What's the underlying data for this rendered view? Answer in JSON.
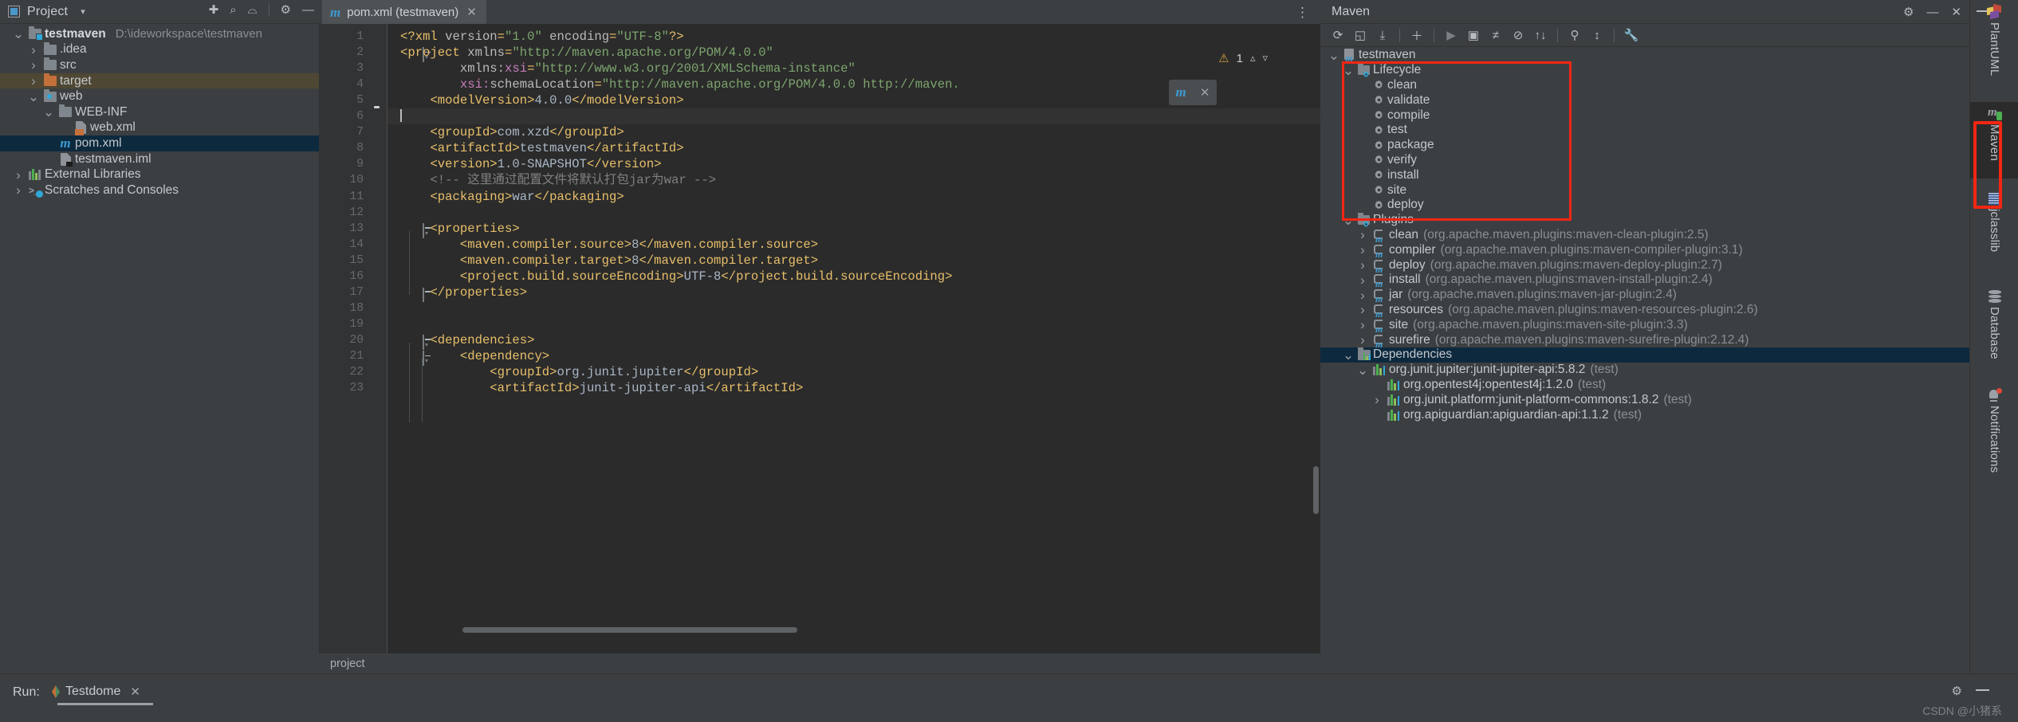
{
  "project_panel": {
    "title": "Project",
    "caret_icon": "chevron-down-icon",
    "toolbar_icons": [
      "locate-icon",
      "expand-all-icon",
      "collapse-all-icon",
      "gear-icon",
      "hide-icon"
    ],
    "tree": [
      {
        "label": "testmaven",
        "path": "D:\\ideworkspace\\testmaven",
        "icon": "module-folder-icon",
        "indent": 0,
        "expanded": true,
        "bold": true,
        "selected": "none"
      },
      {
        "label": ".idea",
        "path": "",
        "icon": "folder-icon",
        "indent": 1,
        "expanded": false,
        "bold": false,
        "selected": "none"
      },
      {
        "label": "src",
        "path": "",
        "icon": "folder-icon",
        "indent": 1,
        "expanded": false,
        "bold": false,
        "selected": "none"
      },
      {
        "label": "target",
        "path": "",
        "icon": "folder-orange-icon",
        "indent": 1,
        "expanded": false,
        "bold": false,
        "selected": "amber"
      },
      {
        "label": "web",
        "path": "",
        "icon": "folder-web-icon",
        "indent": 1,
        "expanded": true,
        "bold": false,
        "selected": "none"
      },
      {
        "label": "WEB-INF",
        "path": "",
        "icon": "folder-icon",
        "indent": 2,
        "expanded": true,
        "bold": false,
        "selected": "none"
      },
      {
        "label": "web.xml",
        "path": "",
        "icon": "xml-file-icon",
        "indent": 3,
        "expanded": null,
        "bold": false,
        "selected": "none"
      },
      {
        "label": "pom.xml",
        "path": "",
        "icon": "maven-m-icon",
        "indent": 2,
        "expanded": null,
        "bold": false,
        "selected": "blue"
      },
      {
        "label": "testmaven.iml",
        "path": "",
        "icon": "iml-file-icon",
        "indent": 2,
        "expanded": null,
        "bold": false,
        "selected": "none"
      },
      {
        "label": "External Libraries",
        "path": "",
        "icon": "library-icon",
        "indent": 0,
        "expanded": false,
        "bold": false,
        "selected": "none"
      },
      {
        "label": "Scratches and Consoles",
        "path": "",
        "icon": "scratches-icon",
        "indent": 0,
        "expanded": false,
        "bold": false,
        "selected": "none"
      }
    ]
  },
  "editor": {
    "tab": {
      "label": "pom.xml (testmaven)",
      "icon": "maven-m-icon",
      "close_icon": "close-icon"
    },
    "kebab_icon": "more-options-icon",
    "inspection": {
      "count": "1",
      "warning_icon": "warning-triangle-icon",
      "up_icon": "arrow-up-icon",
      "down_icon": "arrow-down-icon"
    },
    "floating_popup": {
      "icon": "maven-reload-icon",
      "close_icon": "close-icon"
    },
    "breadcrumb": "project",
    "cursor_line": 6,
    "lines": [
      {
        "n": 1,
        "fold": "none",
        "bulb": false,
        "html": "<span class=\"punc\">&lt;?xml </span><span class=\"attr\">version</span><span class=\"punc\">=</span><span class=\"attrv\">\"1.0\"</span><span class=\"attr\"> encoding</span><span class=\"punc\">=</span><span class=\"attrv\">\"UTF-8\"</span><span class=\"punc\">?&gt;</span>"
      },
      {
        "n": 2,
        "fold": "open",
        "bulb": false,
        "html": "<span class=\"tag\">&lt;project </span><span class=\"attr\">xmlns</span><span class=\"punc\">=</span><span class=\"attrv\">\"http://maven.apache.org/POM/4.0.0\"</span>"
      },
      {
        "n": 3,
        "fold": "none",
        "bulb": false,
        "html": "        <span class=\"attr\">xmlns:</span><span class=\"ns\">xsi</span><span class=\"punc\">=</span><span class=\"attrv\">\"http://www.w3.org/2001/XMLSchema-instance\"</span>"
      },
      {
        "n": 4,
        "fold": "none",
        "bulb": false,
        "html": "        <span class=\"ns\">xsi:</span><span class=\"attr\">schemaLocation</span><span class=\"punc\">=</span><span class=\"attrv\">\"http://maven.apache.org/POM/4.0.0 http://maven.</span>"
      },
      {
        "n": 5,
        "fold": "none",
        "bulb": true,
        "html": "    <span class=\"tag\">&lt;modelVersion&gt;</span><span class=\"txt\">4.0.0</span><span class=\"tag\">&lt;/modelVersion&gt;</span>"
      },
      {
        "n": 6,
        "fold": "none",
        "bulb": false,
        "html": "<span class=\"caret-line\"></span>"
      },
      {
        "n": 7,
        "fold": "none",
        "bulb": false,
        "html": "    <span class=\"tag\">&lt;groupId&gt;</span><span class=\"txt\">com.xzd</span><span class=\"tag\">&lt;/groupId&gt;</span>"
      },
      {
        "n": 8,
        "fold": "none",
        "bulb": false,
        "html": "    <span class=\"tag\">&lt;artifactId&gt;</span><span class=\"txt\">testmaven</span><span class=\"tag\">&lt;/artifactId&gt;</span>"
      },
      {
        "n": 9,
        "fold": "none",
        "bulb": false,
        "html": "    <span class=\"tag\">&lt;version&gt;</span><span class=\"txt\">1.0-SNAPSHOT</span><span class=\"tag\">&lt;/version&gt;</span>"
      },
      {
        "n": 10,
        "fold": "none",
        "bulb": false,
        "html": "    <span class=\"cmt\">&lt;!-- 这里通过配置文件将默认打包jar为war --&gt;</span>"
      },
      {
        "n": 11,
        "fold": "none",
        "bulb": false,
        "html": "    <span class=\"tag\">&lt;packaging&gt;</span><span class=\"txt\">war</span><span class=\"tag\">&lt;/packaging&gt;</span>"
      },
      {
        "n": 12,
        "fold": "none",
        "bulb": false,
        "html": ""
      },
      {
        "n": 13,
        "fold": "open",
        "bulb": false,
        "html": "    <span class=\"tag\">&lt;properties&gt;</span>"
      },
      {
        "n": 14,
        "fold": "none",
        "bulb": false,
        "html": "        <span class=\"tag\">&lt;maven.compiler.source&gt;</span><span class=\"txt\">8</span><span class=\"tag\">&lt;/maven.compiler.source&gt;</span>"
      },
      {
        "n": 15,
        "fold": "none",
        "bulb": false,
        "html": "        <span class=\"tag\">&lt;maven.compiler.target&gt;</span><span class=\"txt\">8</span><span class=\"tag\">&lt;/maven.compiler.target&gt;</span>"
      },
      {
        "n": 16,
        "fold": "none",
        "bulb": false,
        "html": "        <span class=\"tag\">&lt;project.build.sourceEncoding&gt;</span><span class=\"txt\">UTF-8</span><span class=\"tag\">&lt;/project.build.sourceEncoding&gt;</span>"
      },
      {
        "n": 17,
        "fold": "close",
        "bulb": false,
        "html": "    <span class=\"tag\">&lt;/properties&gt;</span>"
      },
      {
        "n": 18,
        "fold": "none",
        "bulb": false,
        "html": ""
      },
      {
        "n": 19,
        "fold": "none",
        "bulb": false,
        "html": ""
      },
      {
        "n": 20,
        "fold": "open",
        "bulb": false,
        "html": "    <span class=\"tag\">&lt;dependencies&gt;</span>"
      },
      {
        "n": 21,
        "fold": "open",
        "bulb": false,
        "html": "        <span class=\"tag\">&lt;dependency&gt;</span>"
      },
      {
        "n": 22,
        "fold": "none",
        "bulb": false,
        "html": "            <span class=\"tag\">&lt;groupId&gt;</span><span class=\"txt\">org.junit.jupiter</span><span class=\"tag\">&lt;/groupId&gt;</span>"
      },
      {
        "n": 23,
        "fold": "none",
        "bulb": false,
        "html": "            <span class=\"tag\">&lt;artifactId&gt;</span><span class=\"txt\">junit-jupiter-api</span><span class=\"tag\">&lt;/artifactId&gt;</span>"
      }
    ]
  },
  "maven_panel": {
    "title": "Maven",
    "header_icons": [
      "gear-icon",
      "hide-icon",
      "close-icon"
    ],
    "toolbar": [
      {
        "name": "reload-all-projects-icon",
        "glyph": "⟳",
        "dim": false
      },
      {
        "name": "add-maven-project-icon",
        "glyph": "◱",
        "dim": false
      },
      {
        "name": "download-sources-icon",
        "glyph": "⤓",
        "dim": false
      },
      {
        "name": "separator",
        "glyph": "",
        "dim": false
      },
      {
        "name": "add-icon",
        "glyph": "＋",
        "dim": false
      },
      {
        "name": "separator",
        "glyph": "",
        "dim": false
      },
      {
        "name": "run-icon",
        "glyph": "▶",
        "dim": true
      },
      {
        "name": "execute-goal-icon",
        "glyph": "▣",
        "dim": false
      },
      {
        "name": "toggle-skip-tests-icon",
        "glyph": "≠",
        "dim": false
      },
      {
        "name": "toggle-offline-icon",
        "glyph": "⊘",
        "dim": false
      },
      {
        "name": "collapse-all-icon",
        "glyph": "↑↓",
        "dim": false
      },
      {
        "name": "separator",
        "glyph": "",
        "dim": false
      },
      {
        "name": "show-dependencies-icon",
        "glyph": "⚲",
        "dim": false
      },
      {
        "name": "expand-icon",
        "glyph": "↕",
        "dim": false
      },
      {
        "name": "separator",
        "glyph": "",
        "dim": false
      },
      {
        "name": "maven-settings-icon",
        "glyph": "🔧",
        "dim": false
      }
    ],
    "root": {
      "label": "testmaven",
      "icon": "maven-module-icon",
      "expanded": true
    },
    "lifecycle": {
      "label": "Lifecycle",
      "icon": "folder-gear-icon",
      "expanded": true,
      "highlighted": true,
      "goals": [
        {
          "label": "clean",
          "icon": "gear-icon"
        },
        {
          "label": "validate",
          "icon": "gear-icon"
        },
        {
          "label": "compile",
          "icon": "gear-icon"
        },
        {
          "label": "test",
          "icon": "gear-icon"
        },
        {
          "label": "package",
          "icon": "gear-icon"
        },
        {
          "label": "verify",
          "icon": "gear-icon"
        },
        {
          "label": "install",
          "icon": "gear-icon"
        },
        {
          "label": "site",
          "icon": "gear-icon"
        },
        {
          "label": "deploy",
          "icon": "gear-icon"
        }
      ]
    },
    "plugins": {
      "label": "Plugins",
      "icon": "folder-gear-icon",
      "expanded": true,
      "items": [
        {
          "name": "clean",
          "coord": "(org.apache.maven.plugins:maven-clean-plugin:2.5)"
        },
        {
          "name": "compiler",
          "coord": "(org.apache.maven.plugins:maven-compiler-plugin:3.1)"
        },
        {
          "name": "deploy",
          "coord": "(org.apache.maven.plugins:maven-deploy-plugin:2.7)"
        },
        {
          "name": "install",
          "coord": "(org.apache.maven.plugins:maven-install-plugin:2.4)"
        },
        {
          "name": "jar",
          "coord": "(org.apache.maven.plugins:maven-jar-plugin:2.4)"
        },
        {
          "name": "resources",
          "coord": "(org.apache.maven.plugins:maven-resources-plugin:2.6)"
        },
        {
          "name": "site",
          "coord": "(org.apache.maven.plugins:maven-site-plugin:3.3)"
        },
        {
          "name": "surefire",
          "coord": "(org.apache.maven.plugins:maven-surefire-plugin:2.12.4)"
        }
      ]
    },
    "dependencies": {
      "label": "Dependencies",
      "icon": "dependencies-folder-icon",
      "expanded": true,
      "selected": true,
      "items": [
        {
          "label": "org.junit.jupiter:junit-jupiter-api:5.8.2",
          "scope": "(test)",
          "indent": 2,
          "expanded": true
        },
        {
          "label": "org.opentest4j:opentest4j:1.2.0",
          "scope": "(test)",
          "indent": 3,
          "expanded": null
        },
        {
          "label": "org.junit.platform:junit-platform-commons:1.8.2",
          "scope": "(test)",
          "indent": 3,
          "expanded": false
        },
        {
          "label": "org.apiguardian:apiguardian-api:1.1.2",
          "scope": "(test)",
          "indent": 3,
          "expanded": null
        }
      ]
    }
  },
  "right_strip": {
    "minus_icon": "hide-icon",
    "tabs": [
      {
        "label": "PlantUML",
        "icon": "plantuml-icon",
        "active": false,
        "highlighted": false
      },
      {
        "label": "Maven",
        "icon": "maven-icon",
        "active": true,
        "highlighted": true
      },
      {
        "label": "jclasslib",
        "icon": "jclasslib-icon",
        "active": false,
        "highlighted": false
      },
      {
        "label": "Database",
        "icon": "database-icon",
        "active": false,
        "highlighted": false
      },
      {
        "label": "Notifications",
        "icon": "notifications-bell-icon",
        "active": false,
        "highlighted": false
      }
    ]
  },
  "run_bar": {
    "label": "Run:",
    "tab": {
      "label": "Testdome",
      "icon": "run-config-icon",
      "close_icon": "close-icon"
    },
    "gear_icon": "gear-icon",
    "minus_icon": "hide-icon",
    "watermark": "CSDN @小猪系"
  },
  "colors": {
    "panel_bg": "#3c3f41",
    "editor_bg": "#2b2b2b",
    "accent_blue": "#4a88c7",
    "selection_blue": "#0d293e",
    "selection_amber": "#4e4734",
    "highlight_red": "#f22613",
    "tag_orange": "#e8bf6a",
    "string_green": "#7da56e"
  }
}
